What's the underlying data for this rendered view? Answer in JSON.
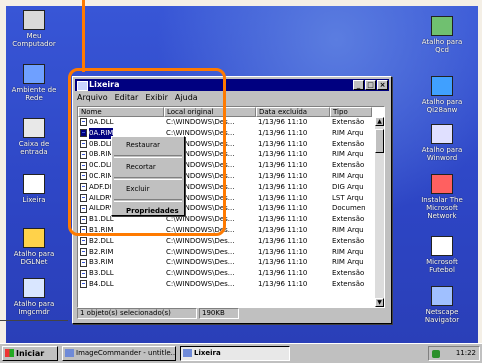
{
  "desktop_icons_left": [
    {
      "label": "Meu\nComputador",
      "icon": "my-computer-icon"
    },
    {
      "label": "Ambiente de\nRede",
      "icon": "network-icon"
    },
    {
      "label": "Caixa de\nentrada",
      "icon": "inbox-icon"
    },
    {
      "label": "Lixeira",
      "icon": "recycle-bin-icon"
    },
    {
      "label": "Atalho para\nDGLNet",
      "icon": "shortcut-icon"
    },
    {
      "label": "Atalho para\nImgcmdr",
      "icon": "shortcut-icon"
    }
  ],
  "desktop_icons_right": [
    {
      "label": "Atalho para\nQcd",
      "icon": "shortcut-icon"
    },
    {
      "label": "Atalho para\nQi28anw",
      "icon": "shortcut-icon"
    },
    {
      "label": "Atalho para\nWinword",
      "icon": "shortcut-icon"
    },
    {
      "label": "Instalar The\nMicrosoft\nNetwork",
      "icon": "msn-icon"
    },
    {
      "label": "Microsoft\nFutebol",
      "icon": "soccer-icon"
    },
    {
      "label": "Netscape\nNavigator",
      "icon": "netscape-icon"
    }
  ],
  "window": {
    "title": "Lixeira",
    "menu": [
      "Arquivo",
      "Editar",
      "Exibir",
      "Ajuda"
    ],
    "columns": [
      "Nome",
      "Local original",
      "Data excluída",
      "Tipo"
    ],
    "rows": [
      [
        "0A.DLL",
        "C:\\WINDOWS\\Des...",
        "1/13/96 11:10",
        "Extensão"
      ],
      [
        "0A.RIM",
        "C:\\WINDOWS\\Des...",
        "1/13/96 11:10",
        "RIM Arqu"
      ],
      [
        "0B.DLL",
        "C:\\WINDOWS\\Des...",
        "1/13/96 11:10",
        "Extensão"
      ],
      [
        "0B.RIM",
        "C:\\WINDOWS\\Des...",
        "1/13/96 11:10",
        "RIM Arqu"
      ],
      [
        "0C.DLL",
        "C:\\WINDOWS\\Des...",
        "1/13/96 11:10",
        "Extensão"
      ],
      [
        "0C.RIM",
        "C:\\WINDOWS\\Des...",
        "1/13/96 11:10",
        "RIM Arqu"
      ],
      [
        "ADF.DIG",
        "C:\\WINDOWS\\Des...",
        "1/13/96 11:10",
        "DIG Arqu"
      ],
      [
        "AILDRVR.LST",
        "C:\\WINDOWS\\Des...",
        "1/13/96 11:10",
        "LST Arqu"
      ],
      [
        "AILDRVR.DOC",
        "C:\\WINDOWS\\Des...",
        "1/13/96 11:10",
        "Documen"
      ],
      [
        "B1.DLL",
        "C:\\WINDOWS\\Des...",
        "1/13/96 11:10",
        "Extensão"
      ],
      [
        "B1.RIM",
        "C:\\WINDOWS\\Des...",
        "1/13/96 11:10",
        "RIM Arqu"
      ],
      [
        "B2.DLL",
        "C:\\WINDOWS\\Des...",
        "1/13/96 11:10",
        "Extensão"
      ],
      [
        "B2.RIM",
        "C:\\WINDOWS\\Des...",
        "1/13/96 11:10",
        "RIM Arqu"
      ],
      [
        "B3.RIM",
        "C:\\WINDOWS\\Des...",
        "1/13/96 11:10",
        "RIM Arqu"
      ],
      [
        "B3.DLL",
        "C:\\WINDOWS\\Des...",
        "1/13/96 11:10",
        "Extensão"
      ],
      [
        "B4.DLL",
        "C:\\WINDOWS\\Des...",
        "1/13/96 11:10",
        "Extensão"
      ]
    ],
    "selected_row": 1,
    "status": [
      "1 objeto(s) selecionado(s)",
      "190KB"
    ]
  },
  "context_menu": {
    "items": [
      {
        "label": "Restaurar",
        "bold": false
      },
      {
        "label": "Recortar",
        "bold": false
      },
      {
        "label": "Excluir",
        "bold": false
      },
      {
        "label": "Propriedades",
        "bold": true
      }
    ]
  },
  "taskbar": {
    "start": "Iniciar",
    "buttons": [
      {
        "label": "ImageCommander - untitle...",
        "active": false
      },
      {
        "label": "Lixeira",
        "active": true
      }
    ],
    "clock": "11:22"
  },
  "colors": {
    "accent": "#ff7a00",
    "titlebar": "#000080",
    "desktop": "#2c46c3"
  }
}
